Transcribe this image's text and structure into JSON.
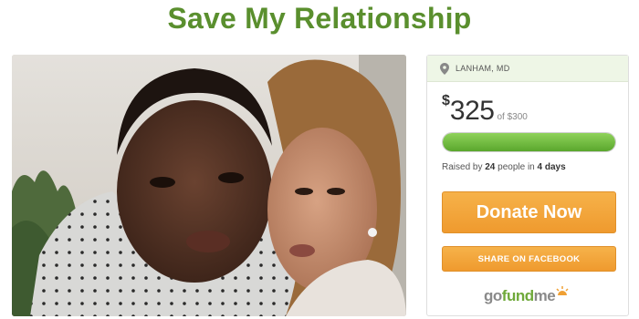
{
  "page": {
    "title": "Save My Relationship"
  },
  "campaign": {
    "location": "LANHAM, MD",
    "currency_symbol": "$",
    "raised_amount": "325",
    "goal_text": "of $300",
    "progress_fraction": 1.0,
    "raised_by_prefix": "Raised by ",
    "raised_by_count": "24",
    "raised_by_middle": " people in ",
    "raised_by_days": "4 days"
  },
  "buttons": {
    "donate_label": "Donate Now",
    "share_label": "SHARE ON FACEBOOK"
  },
  "brand": {
    "logo_go": "go",
    "logo_fund": "fund",
    "logo_me": "me"
  },
  "colors": {
    "title_green": "#5a8f2e",
    "donate_orange": "#f0a033",
    "progress_green": "#6db83a"
  },
  "icons": {
    "location": "map-pin-icon",
    "logo_sun": "sun-icon"
  }
}
